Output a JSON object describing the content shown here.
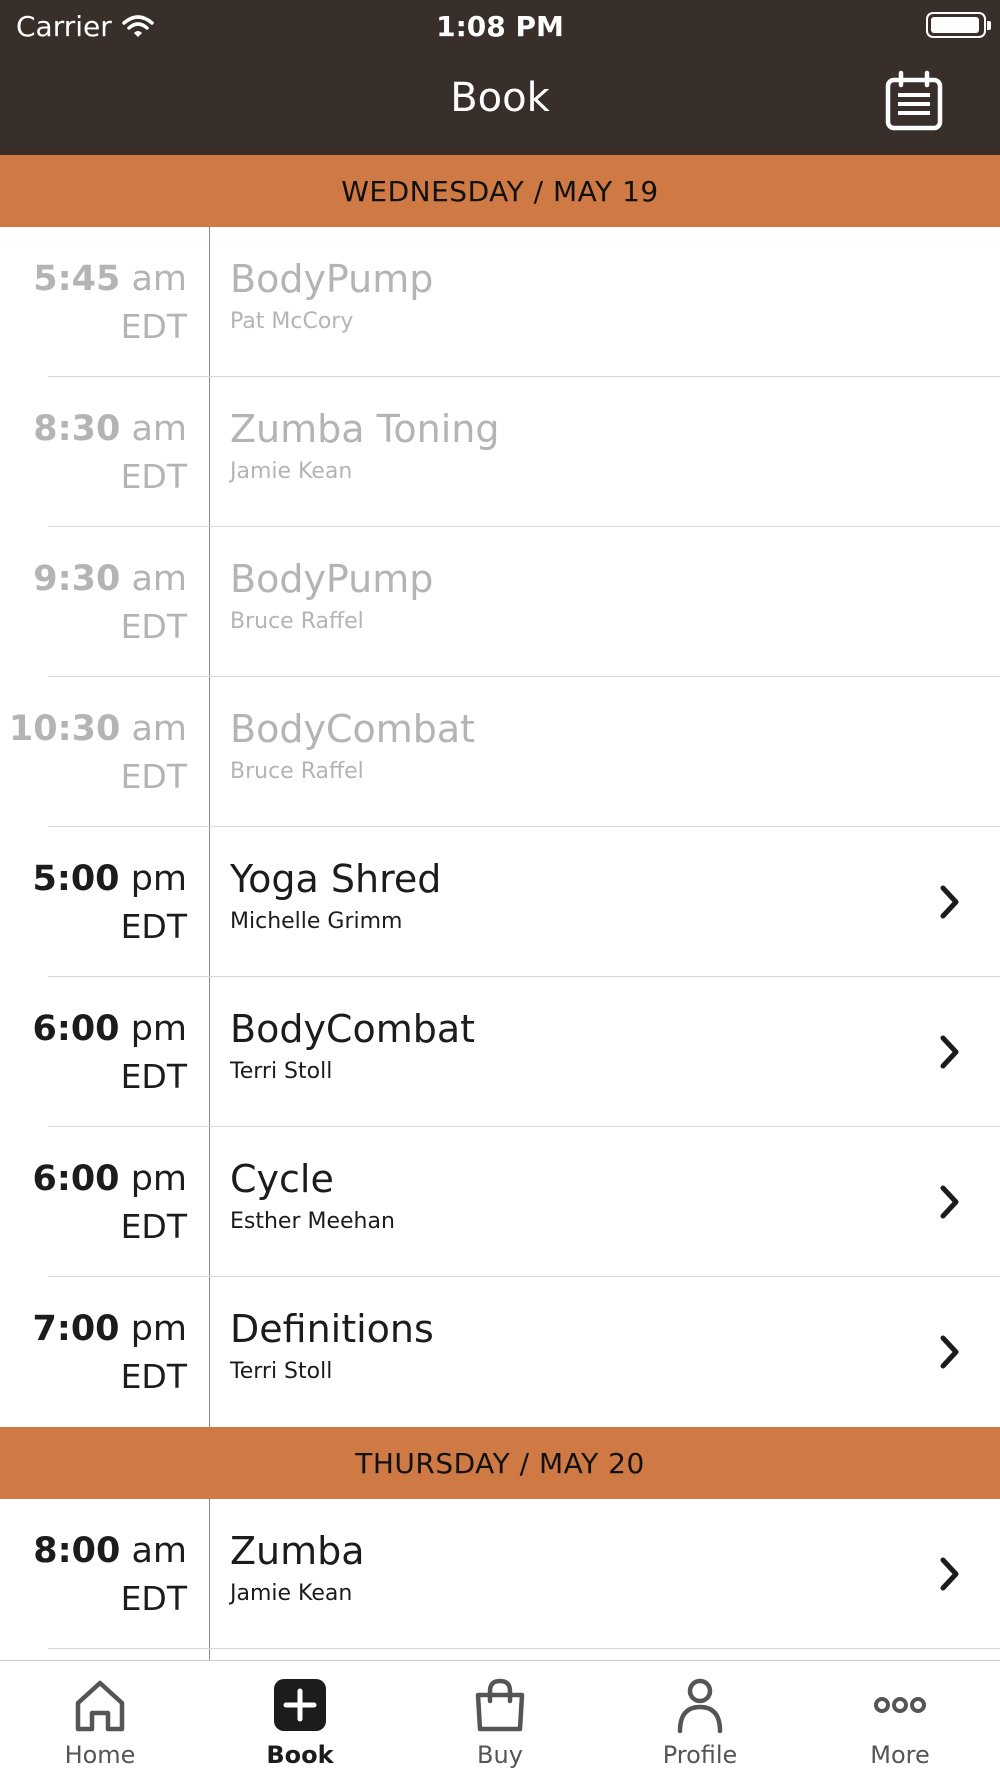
{
  "status_bar": {
    "carrier": "Carrier",
    "time": "1:08 PM"
  },
  "header": {
    "title": "Book",
    "calendar_icon": "calendar-icon"
  },
  "days": [
    {
      "label": "WEDNESDAY / MAY 19",
      "classes": [
        {
          "time": "5:45",
          "ampm": "am",
          "tz": "EDT",
          "name": "BodyPump",
          "instructor": "Pat McCory",
          "bookable": false
        },
        {
          "time": "8:30",
          "ampm": "am",
          "tz": "EDT",
          "name": "Zumba Toning",
          "instructor": "Jamie Kean",
          "bookable": false
        },
        {
          "time": "9:30",
          "ampm": "am",
          "tz": "EDT",
          "name": "BodyPump",
          "instructor": "Bruce Raffel",
          "bookable": false
        },
        {
          "time": "10:30",
          "ampm": "am",
          "tz": "EDT",
          "name": "BodyCombat",
          "instructor": "Bruce Raffel",
          "bookable": false
        },
        {
          "time": "5:00",
          "ampm": "pm",
          "tz": "EDT",
          "name": "Yoga Shred",
          "instructor": "Michelle Grimm",
          "bookable": true
        },
        {
          "time": "6:00",
          "ampm": "pm",
          "tz": "EDT",
          "name": "BodyCombat",
          "instructor": "Terri Stoll",
          "bookable": true
        },
        {
          "time": "6:00",
          "ampm": "pm",
          "tz": "EDT",
          "name": "Cycle",
          "instructor": "Esther Meehan",
          "bookable": true
        },
        {
          "time": "7:00",
          "ampm": "pm",
          "tz": "EDT",
          "name": "Definitions",
          "instructor": "Terri Stoll",
          "bookable": true
        }
      ]
    },
    {
      "label": "THURSDAY / MAY 20",
      "classes": [
        {
          "time": "8:00",
          "ampm": "am",
          "tz": "EDT",
          "name": "Zumba",
          "instructor": "Jamie Kean",
          "bookable": true
        }
      ]
    }
  ],
  "tabs": [
    {
      "label": "Home",
      "icon": "home-icon",
      "active": false
    },
    {
      "label": "Book",
      "icon": "plus-square-icon",
      "active": true
    },
    {
      "label": "Buy",
      "icon": "shopping-bag-icon",
      "active": false
    },
    {
      "label": "Profile",
      "icon": "person-icon",
      "active": false
    },
    {
      "label": "More",
      "icon": "more-dots-icon",
      "active": false
    }
  ],
  "colors": {
    "header_bg": "#382e2a",
    "day_header_bg": "#cf7a44",
    "past_text": "#b4b4b4",
    "active_text": "#1c1c1c"
  }
}
